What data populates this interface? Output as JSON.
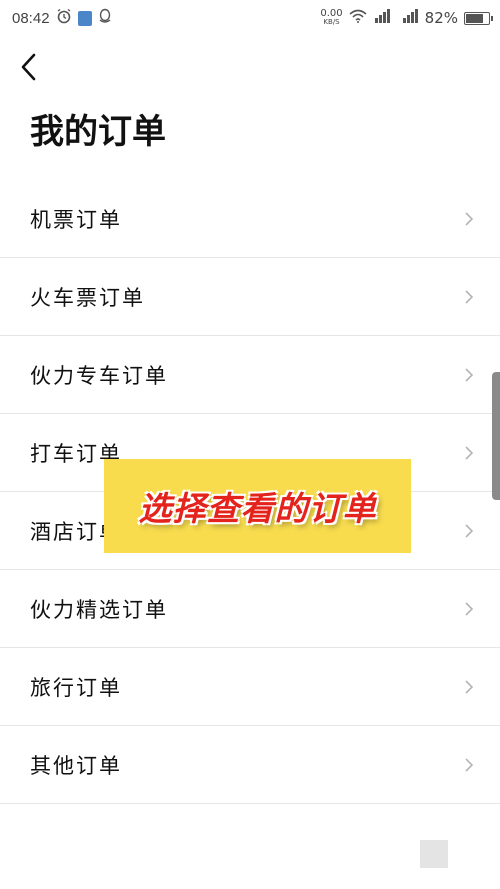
{
  "status_bar": {
    "time": "08:42",
    "speed_value": "0.00",
    "speed_unit": "KB/S",
    "battery_percent": "82%",
    "battery_level": 0.82,
    "icons": [
      "alarm-icon",
      "shield-icon",
      "qq-icon",
      "wifi-icon",
      "signal-icon",
      "4g-signal-icon",
      "battery-icon"
    ]
  },
  "header": {
    "back_icon": "chevron-left-icon",
    "title": "我的订单"
  },
  "orders": [
    {
      "label": "机票订单"
    },
    {
      "label": "火车票订单"
    },
    {
      "label": "伙力专车订单"
    },
    {
      "label": "打车订单"
    },
    {
      "label": "酒店订单"
    },
    {
      "label": "伙力精选订单"
    },
    {
      "label": "旅行订单"
    },
    {
      "label": "其他订单"
    }
  ],
  "overlay": {
    "text": "选择查看的订单",
    "background": "#f8dc4e",
    "text_color": "#e4231d"
  }
}
